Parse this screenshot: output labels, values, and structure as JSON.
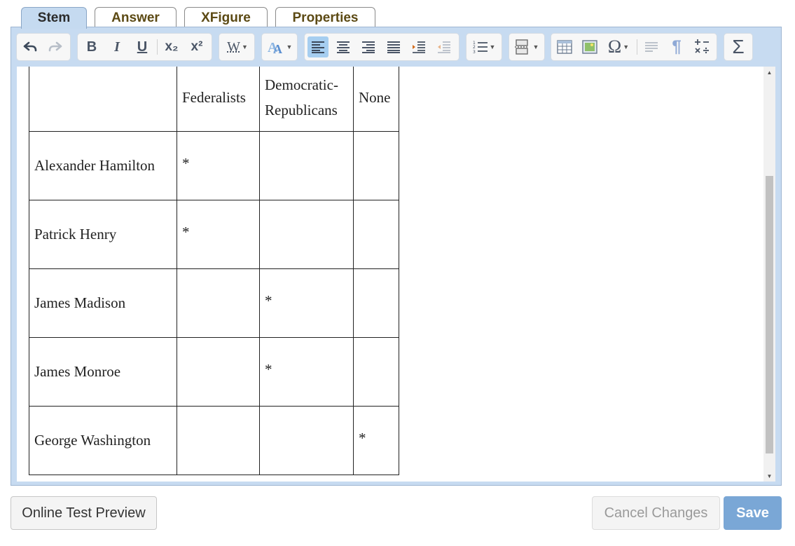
{
  "tabs": [
    {
      "label": "Stem",
      "active": true
    },
    {
      "label": "Answer",
      "active": false
    },
    {
      "label": "XFigure",
      "active": false
    },
    {
      "label": "Properties",
      "active": false
    }
  ],
  "toolbar": {
    "icons": [
      "undo-icon",
      "redo-icon",
      "bold-icon",
      "italic-icon",
      "underline-icon",
      "subscript-icon",
      "superscript-icon",
      "word-format-icon",
      "clear-format-icon",
      "align-left-icon",
      "align-center-icon",
      "align-right-icon",
      "align-justify-icon",
      "indent-icon",
      "outdent-icon",
      "numbered-list-icon",
      "page-break-icon",
      "table-icon",
      "image-icon",
      "special-char-icon",
      "paragraph-icon",
      "pilcrow-icon",
      "math-operators-icon",
      "sigma-icon"
    ],
    "bold": "B",
    "italic": "I",
    "underline": "U",
    "subscript": "x₂",
    "superscript": "x²",
    "word_format": "W",
    "special_char": "Ω",
    "sigma": "Σ",
    "pilcrow": "¶"
  },
  "table": {
    "headers": [
      "",
      "Federalists",
      "Democratic-Republicans",
      "None"
    ],
    "rows": [
      {
        "name": "Alexander Hamilton",
        "marks": [
          "*",
          "",
          ""
        ]
      },
      {
        "name": "Patrick Henry",
        "marks": [
          "*",
          "",
          ""
        ]
      },
      {
        "name": "James Madison",
        "marks": [
          "",
          "*",
          ""
        ]
      },
      {
        "name": "James Monroe",
        "marks": [
          "",
          "*",
          ""
        ]
      },
      {
        "name": "George Washington",
        "marks": [
          "",
          "",
          "*"
        ]
      }
    ]
  },
  "buttons": {
    "preview": "Online Test Preview",
    "cancel": "Cancel Changes",
    "save": "Save"
  },
  "colors": {
    "frame": "#c7dbf1",
    "save": "#7aa7d6",
    "active_tool": "#a6cef0"
  }
}
